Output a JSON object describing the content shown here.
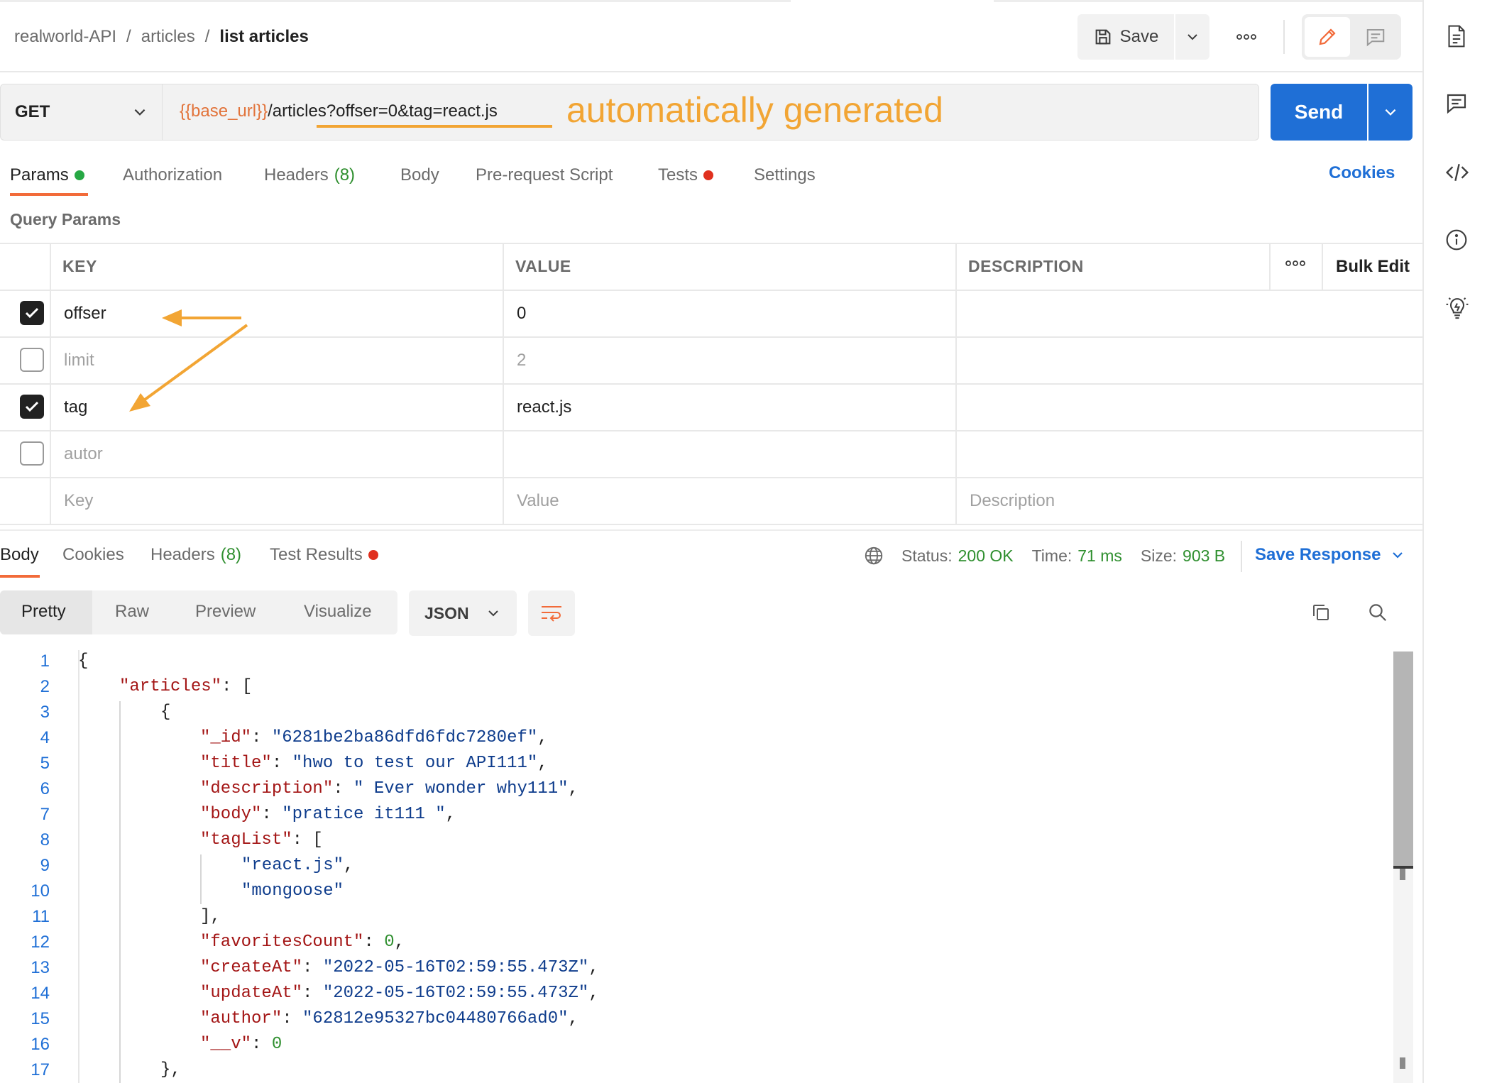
{
  "breadcrumb": {
    "items": [
      "realworld-API",
      "articles"
    ],
    "separator": "/",
    "current": "list articles"
  },
  "header": {
    "save_label": "Save",
    "more_icon": "more-horizontal-icon",
    "edit_icon": "pencil-icon",
    "comment_icon": "comment-icon"
  },
  "request": {
    "method": "GET",
    "url_variable": "{{base_url}}",
    "url_path": "/articles?offser=0&tag=react.js",
    "annotation": "automatically generated",
    "send_label": "Send"
  },
  "request_tabs": {
    "params": "Params",
    "authorization": "Authorization",
    "headers": "Headers",
    "headers_count": "(8)",
    "body": "Body",
    "prerequest": "Pre-request Script",
    "tests": "Tests",
    "settings": "Settings",
    "cookies": "Cookies"
  },
  "query_params": {
    "title": "Query Params",
    "columns": {
      "key": "KEY",
      "value": "VALUE",
      "description": "DESCRIPTION"
    },
    "bulk_edit": "Bulk Edit",
    "rows": [
      {
        "checked": true,
        "key": "offser",
        "value": "0"
      },
      {
        "checked": false,
        "key": "limit",
        "value": "2"
      },
      {
        "checked": true,
        "key": "tag",
        "value": "react.js"
      },
      {
        "checked": false,
        "key": "autor",
        "value": ""
      }
    ],
    "placeholders": {
      "key": "Key",
      "value": "Value",
      "description": "Description"
    }
  },
  "response_tabs": {
    "body": "Body",
    "cookies": "Cookies",
    "headers": "Headers",
    "headers_count": "(8)",
    "test_results": "Test Results"
  },
  "response_status": {
    "status_label": "Status:",
    "status_value": "200 OK",
    "time_label": "Time:",
    "time_value": "71 ms",
    "size_label": "Size:",
    "size_value": "903 B",
    "save_response": "Save Response"
  },
  "view_modes": {
    "pretty": "Pretty",
    "raw": "Raw",
    "preview": "Preview",
    "visualize": "Visualize",
    "format": "JSON"
  },
  "code_lines": {
    "n1": "1",
    "n2": "2",
    "n3": "3",
    "n4": "4",
    "n5": "5",
    "n6": "6",
    "n7": "7",
    "n8": "8",
    "n9": "9",
    "n10": "10",
    "n11": "11",
    "n12": "12",
    "n13": "13",
    "n14": "14",
    "n15": "15",
    "n16": "16",
    "n17": "17",
    "l1": "{",
    "l2_key": "\"articles\"",
    "l2_rest": ": [",
    "l3": "{",
    "l4_key": "\"_id\"",
    "l4_val": "\"6281be2ba86dfd6fdc7280ef\"",
    "l5_key": "\"title\"",
    "l5_val": "\"hwo to test our API111\"",
    "l6_key": "\"description\"",
    "l6_val": "\" Ever wonder why111\"",
    "l7_key": "\"body\"",
    "l7_val": "\"pratice it111 \"",
    "l8_key": "\"tagList\"",
    "l8_rest": ": [",
    "l9_val": "\"react.js\"",
    "l10_val": "\"mongoose\"",
    "l11": "],",
    "l12_key": "\"favoritesCount\"",
    "l12_val": "0",
    "l13_key": "\"createAt\"",
    "l13_val": "\"2022-05-16T02:59:55.473Z\"",
    "l14_key": "\"updateAt\"",
    "l14_val": "\"2022-05-16T02:59:55.473Z\"",
    "l15_key": "\"author\"",
    "l15_val": "\"62812e95327bc04480766ad0\"",
    "l16_key": "\"__v\"",
    "l16_val": "0",
    "l17": "},"
  },
  "colors": {
    "accent_orange": "#f26b3a",
    "annotation_orange": "#f2a534",
    "send_blue": "#1f6fd6",
    "success_green": "#2f8f2f",
    "dot_red": "#e0301e"
  }
}
